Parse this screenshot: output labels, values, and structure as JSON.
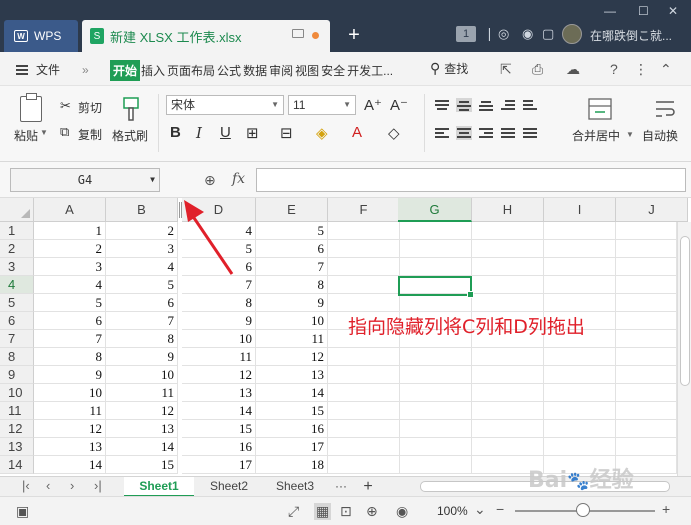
{
  "titlebar": {
    "wps_tab": "WPS",
    "file_tab": "新建 XLSX 工作表.xlsx",
    "tab_count": "1",
    "user_name": "在哪跌倒こ就..."
  },
  "menubar": {
    "file_label": "文件",
    "items": [
      "开始",
      "插入",
      "页面布局",
      "公式",
      "数据",
      "审阅",
      "视图",
      "安全",
      "开发工..."
    ],
    "search_label": "查找"
  },
  "ribbon": {
    "paste": "粘贴",
    "cut": "剪切",
    "copy": "复制",
    "format_painter": "格式刷",
    "font_name": "宋体",
    "font_size": "11",
    "merge_center": "合并居中",
    "auto_wrap": "自动换"
  },
  "formulabar": {
    "cell_ref": "G4",
    "fx": "fx"
  },
  "grid": {
    "columns": [
      "A",
      "B",
      "D",
      "E",
      "F",
      "G",
      "H",
      "I",
      "J"
    ],
    "selected_column": "G",
    "selected_row": "4",
    "rows": [
      {
        "n": "1",
        "a": "1",
        "b": "2",
        "d": "4",
        "e": "5"
      },
      {
        "n": "2",
        "a": "2",
        "b": "3",
        "d": "5",
        "e": "6"
      },
      {
        "n": "3",
        "a": "3",
        "b": "4",
        "d": "6",
        "e": "7"
      },
      {
        "n": "4",
        "a": "4",
        "b": "5",
        "d": "7",
        "e": "8"
      },
      {
        "n": "5",
        "a": "5",
        "b": "6",
        "d": "8",
        "e": "9"
      },
      {
        "n": "6",
        "a": "6",
        "b": "7",
        "d": "9",
        "e": "10"
      },
      {
        "n": "7",
        "a": "7",
        "b": "8",
        "d": "10",
        "e": "11"
      },
      {
        "n": "8",
        "a": "8",
        "b": "9",
        "d": "11",
        "e": "12"
      },
      {
        "n": "9",
        "a": "9",
        "b": "10",
        "d": "12",
        "e": "13"
      },
      {
        "n": "10",
        "a": "10",
        "b": "11",
        "d": "13",
        "e": "14"
      },
      {
        "n": "11",
        "a": "11",
        "b": "12",
        "d": "14",
        "e": "15"
      },
      {
        "n": "12",
        "a": "12",
        "b": "13",
        "d": "15",
        "e": "16"
      },
      {
        "n": "13",
        "a": "13",
        "b": "14",
        "d": "16",
        "e": "17"
      },
      {
        "n": "14",
        "a": "14",
        "b": "15",
        "d": "17",
        "e": "18"
      }
    ],
    "annotation": "指向隐藏列将C列和D列拖出",
    "annotation_color": "#e0202a"
  },
  "sheets": {
    "tabs": [
      "Sheet1",
      "Sheet2",
      "Sheet3"
    ],
    "active": "Sheet1",
    "more": "···",
    "add": "+"
  },
  "statusbar": {
    "zoom": "100%"
  },
  "colors": {
    "accent": "#1f9d55",
    "titlebar": "#2d3a4c"
  },
  "watermark": "Baidu 经验"
}
